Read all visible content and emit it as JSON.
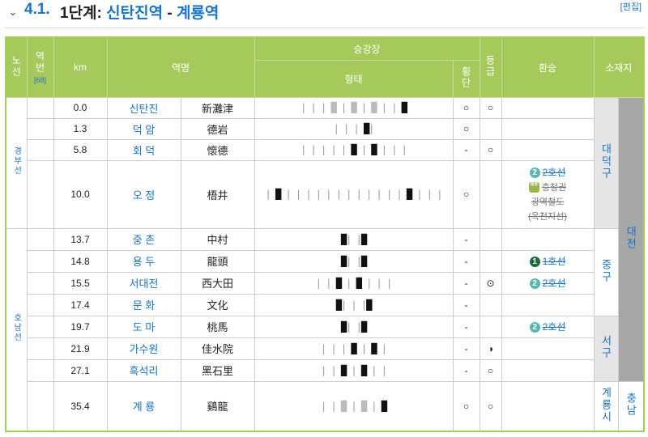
{
  "heading": {
    "chevron": "⌄",
    "number": "4.1.",
    "title_prefix": "1단계:",
    "from": "신탄진역",
    "dash": "-",
    "to": "계룡역",
    "edit": "[편집]"
  },
  "header": {
    "line": "노선",
    "no": "역번",
    "no_note": "[68]",
    "km": "km",
    "name": "역명",
    "platform": "승강장",
    "shape": "형태",
    "cross": "횡단",
    "grade": "등급",
    "transfer": "환승",
    "location": "소재지"
  },
  "lines": {
    "gyeongbu": "경부선",
    "honam": "호남선"
  },
  "rows": [
    {
      "km": "0.0",
      "name": "신탄진",
      "hanja": "新灘津",
      "cross": "○",
      "grade": "○"
    },
    {
      "km": "1.3",
      "name": "덕 암",
      "hanja": "德岩",
      "cross": "○",
      "grade": ""
    },
    {
      "km": "5.8",
      "name": "회 덕",
      "hanja": "懷德",
      "cross": "-",
      "grade": "○"
    },
    {
      "km": "10.0",
      "name": "오 정",
      "hanja": "梧井",
      "cross": "○",
      "grade": ""
    },
    {
      "km": "13.7",
      "name": "중 촌",
      "hanja": "中村",
      "cross": "-",
      "grade": ""
    },
    {
      "km": "14.8",
      "name": "용 두",
      "hanja": "龍頭",
      "cross": "-",
      "grade": ""
    },
    {
      "km": "15.5",
      "name": "서대전",
      "hanja": "西大田",
      "cross": "-",
      "grade": "⊙"
    },
    {
      "km": "17.4",
      "name": "문 화",
      "hanja": "文化",
      "cross": "-",
      "grade": ""
    },
    {
      "km": "19.7",
      "name": "도 마",
      "hanja": "桃馬",
      "cross": "-",
      "grade": ""
    },
    {
      "km": "21.9",
      "name": "가수원",
      "hanja": "佳水院",
      "cross": "-",
      "grade": "◑"
    },
    {
      "km": "27.1",
      "name": "흑석리",
      "hanja": "黑石里",
      "cross": "-",
      "grade": "○"
    },
    {
      "km": "35.4",
      "name": "계 룡",
      "hanja": "鷄龍",
      "cross": "○",
      "grade": "○"
    }
  ],
  "transfers": {
    "ojeong": {
      "line2_num": "2",
      "line2": "2호선",
      "cc_badge": "충청",
      "cc": "충청권",
      "cc2": "광역철도",
      "cc3": "(옥천지선)"
    },
    "yongdu": {
      "num": "1",
      "name": "1호선"
    },
    "seodaejeon": {
      "num": "2",
      "name": "2호선"
    },
    "doma": {
      "num": "2",
      "name": "2호선"
    }
  },
  "locations": {
    "daedeok": "대덕구",
    "jung": "중구",
    "seo": "서구",
    "daejeon": "대전",
    "gyeryong": "계룡시",
    "chungnam": "충남"
  }
}
